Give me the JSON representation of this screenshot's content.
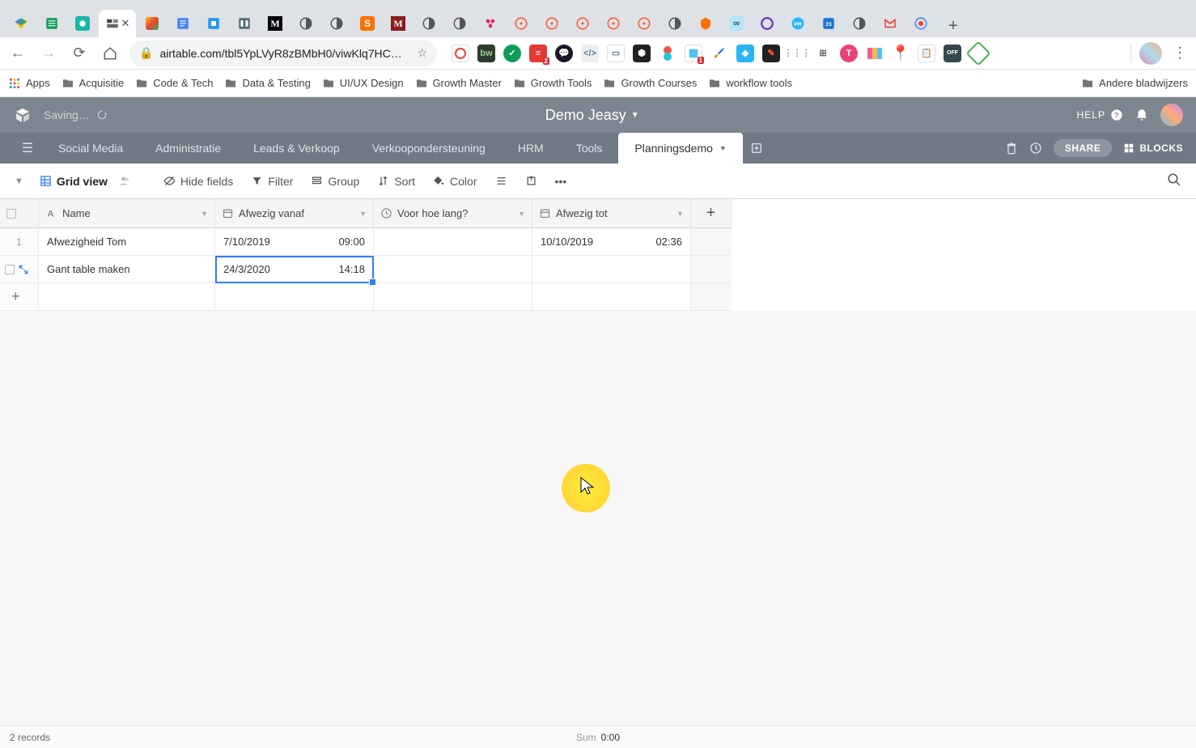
{
  "browser": {
    "url": "airtable.com/tbl5YpLVyR8zBMbH0/viwKlq7HC…",
    "bookmarks": {
      "apps": "Apps",
      "folders": [
        "Acquisitie",
        "Code & Tech",
        "Data & Testing",
        "UI/UX Design",
        "Growth Master",
        "Growth Tools",
        "Growth Courses",
        "workflow tools"
      ],
      "other": "Andere bladwijzers"
    }
  },
  "airtable": {
    "saving": "Saving…",
    "base_title": "Demo Jeasy",
    "help": "HELP",
    "share": "SHARE",
    "blocks": "BLOCKS",
    "tabs": [
      "Social Media",
      "Administratie",
      "Leads & Verkoop",
      "Verkoopondersteuning",
      "HRM",
      "Tools",
      "Planningsdemo"
    ],
    "active_tab": "Planningsdemo"
  },
  "viewbar": {
    "grid_view": "Grid view",
    "hide_fields": "Hide fields",
    "filter": "Filter",
    "group": "Group",
    "sort": "Sort",
    "color": "Color"
  },
  "table": {
    "columns": [
      "Name",
      "Afwezig vanaf",
      "Voor hoe lang?",
      "Afwezig tot"
    ],
    "rows": [
      {
        "num": "1",
        "name": "Afwezigheid Tom",
        "vanaf_date": "7/10/2019",
        "vanaf_time": "09:00",
        "duur": "",
        "tot_date": "10/10/2019",
        "tot_time": "02:36"
      },
      {
        "num": "",
        "name": "Gant table maken",
        "vanaf_date": "24/3/2020",
        "vanaf_time": "14:18",
        "duur": "",
        "tot_date": "",
        "tot_time": ""
      }
    ]
  },
  "status": {
    "records": "2 records",
    "sum_label": "Sum",
    "sum_value": "0:00"
  }
}
